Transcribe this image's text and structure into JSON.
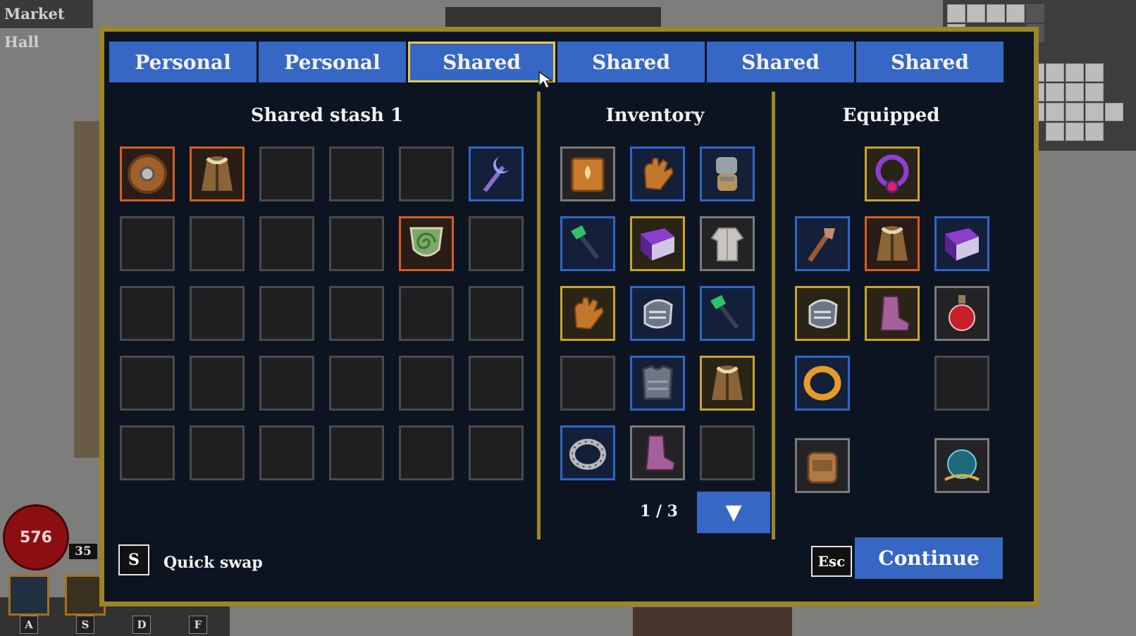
{
  "location": {
    "title": "Market Hall"
  },
  "tabs": [
    {
      "label": "Personal"
    },
    {
      "label": "Personal"
    },
    {
      "label": "Shared",
      "active": true
    },
    {
      "label": "Shared"
    },
    {
      "label": "Shared"
    },
    {
      "label": "Shared"
    }
  ],
  "stash": {
    "title": "Shared stash 1",
    "slots": [
      {
        "item": "round-shield",
        "quality": "orange"
      },
      {
        "item": "cloak",
        "quality": "orange"
      },
      {
        "item": null
      },
      {
        "item": null
      },
      {
        "item": null
      },
      {
        "item": "moon-staff",
        "quality": "blue"
      },
      {
        "item": null
      },
      {
        "item": null
      },
      {
        "item": null
      },
      {
        "item": null
      },
      {
        "item": "spiral-shield",
        "quality": "orange"
      },
      {
        "item": null
      },
      {
        "item": null
      },
      {
        "item": null
      },
      {
        "item": null
      },
      {
        "item": null
      },
      {
        "item": null
      },
      {
        "item": null
      },
      {
        "item": null
      },
      {
        "item": null
      },
      {
        "item": null
      },
      {
        "item": null
      },
      {
        "item": null
      },
      {
        "item": null
      },
      {
        "item": null
      },
      {
        "item": null
      },
      {
        "item": null
      },
      {
        "item": null
      },
      {
        "item": null
      },
      {
        "item": null
      }
    ]
  },
  "inventory": {
    "title": "Inventory",
    "page": "1 / 3",
    "next_icon": "▼",
    "slots": [
      {
        "item": "spell-book",
        "quality": "gray"
      },
      {
        "item": "leather-glove",
        "quality": "blue"
      },
      {
        "item": "plate-gauntlet",
        "quality": "blue"
      },
      {
        "item": "emerald-wand",
        "quality": "blue"
      },
      {
        "item": "purple-tome",
        "quality": "gold"
      },
      {
        "item": "cloth-robe",
        "quality": "gray"
      },
      {
        "item": "leather-glove",
        "quality": "gold"
      },
      {
        "item": "steel-gauntlet",
        "quality": "blue"
      },
      {
        "item": "emerald-wand",
        "quality": "blue"
      },
      {
        "item": null
      },
      {
        "item": "chest-plate",
        "quality": "blue"
      },
      {
        "item": "cloak",
        "quality": "gold"
      },
      {
        "item": "iron-ring",
        "quality": "blue"
      },
      {
        "item": "boots",
        "quality": "gray"
      },
      {
        "item": null
      }
    ]
  },
  "equipped": {
    "title": "Equipped",
    "slots": [
      {
        "slot": "amulet",
        "item": "amulet",
        "quality": "gold"
      },
      {
        "slot": "weapon",
        "item": "wooden-staff",
        "quality": "blue"
      },
      {
        "slot": "body",
        "item": "cloak",
        "quality": "orange"
      },
      {
        "slot": "offhand",
        "item": "purple-tome",
        "quality": "blue"
      },
      {
        "slot": "hands",
        "item": "steel-gauntlet",
        "quality": "gold"
      },
      {
        "slot": "feet",
        "item": "boots",
        "quality": "gold"
      },
      {
        "slot": "potion",
        "item": "potion",
        "quality": "gray"
      },
      {
        "slot": "ring",
        "item": "gold-ring",
        "quality": "blue"
      },
      {
        "slot": "trinket",
        "item": null
      },
      {
        "slot": "bag",
        "item": "backpack",
        "quality": "gray"
      },
      {
        "slot": "orb",
        "item": "orb",
        "quality": "gray"
      }
    ]
  },
  "footer": {
    "quick_swap_key": "S",
    "quick_swap_label": "Quick swap",
    "esc_key": "Esc",
    "continue_label": "Continue"
  },
  "hud": {
    "health": "576",
    "level": "35",
    "hotkeys": [
      "A",
      "S",
      "D",
      "F"
    ]
  },
  "colors": {
    "tab_blue": "#3667c4",
    "active_outline": "#e8c84a",
    "panel_border": "#9c8526",
    "quality_orange": "#d45f1f",
    "quality_blue": "#2f66c9",
    "quality_gold": "#c9a52c",
    "quality_gray": "#7a7a7a"
  }
}
